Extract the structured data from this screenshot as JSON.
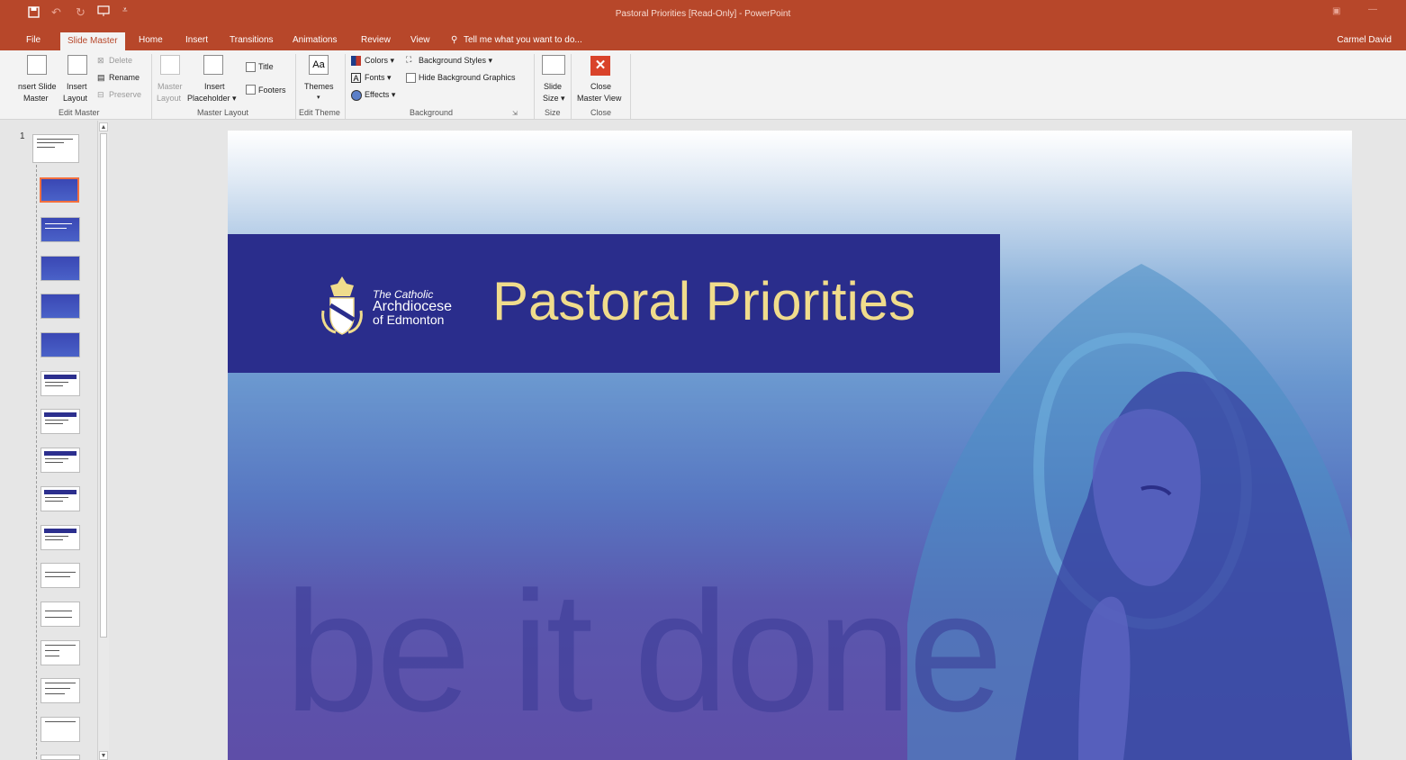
{
  "window": {
    "title": "Pastoral Priorities [Read-Only] - PowerPoint",
    "user": "Carmel David"
  },
  "tabs": [
    {
      "label": "File"
    },
    {
      "label": "Slide Master",
      "active": true
    },
    {
      "label": "Home"
    },
    {
      "label": "Insert"
    },
    {
      "label": "Transitions"
    },
    {
      "label": "Animations"
    },
    {
      "label": "Review"
    },
    {
      "label": "View"
    },
    {
      "label": "Tell me what you want to do..."
    }
  ],
  "ribbon": {
    "edit_master": {
      "insert_slide_master": [
        "nsert Slide",
        "Master"
      ],
      "insert_layout": [
        "Insert",
        "Layout"
      ],
      "delete": "Delete",
      "rename": "Rename",
      "preserve": "Preserve",
      "group_label": "Edit Master"
    },
    "master_layout": {
      "master_layout": [
        "Master",
        "Layout"
      ],
      "insert_placeholder": [
        "Insert",
        "Placeholder ▾"
      ],
      "title": "Title",
      "footers": "Footers",
      "group_label": "Master Layout"
    },
    "edit_theme": {
      "themes": "Themes",
      "group_label": "Edit Theme"
    },
    "background": {
      "colors": "Colors ▾",
      "fonts": "Fonts ▾",
      "effects": "Effects ▾",
      "background_styles": "Background Styles ▾",
      "hide_background_graphics": "Hide Background Graphics",
      "group_label": "Background"
    },
    "size": {
      "slide_size": [
        "Slide",
        "Size ▾"
      ],
      "group_label": "Size"
    },
    "close": {
      "close_master_view": [
        "Close",
        "Master View"
      ],
      "group_label": "Close"
    }
  },
  "thumbnails": {
    "slide_number": "1"
  },
  "slide": {
    "archdiocese_lines": [
      "The Catholic",
      "Archdiocese",
      "of Edmonton"
    ],
    "title": "Pastoral Priorities",
    "tagline": "be it done"
  },
  "colors": {
    "title_bar": "#b7472a",
    "title_band": "#2a2d8c",
    "title_text": "#f0dc8c",
    "selected_thumb": "#f36f3e"
  }
}
